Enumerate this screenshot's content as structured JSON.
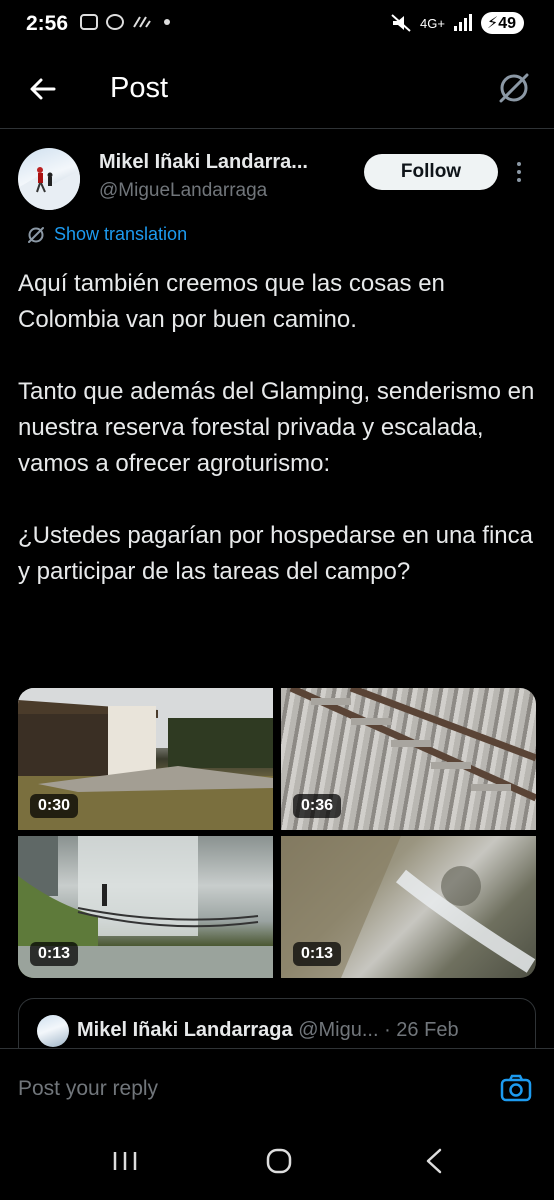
{
  "status_bar": {
    "time": "2:56",
    "network": "4G+",
    "battery": "49"
  },
  "header": {
    "title": "Post"
  },
  "author": {
    "name": "Mikel Iñaki Landarra...",
    "handle": "@MigueLandarraga"
  },
  "follow_label": "Follow",
  "translate_label": "Show translation",
  "post": {
    "text": "Aquí también creemos que las cosas en Colombia van por buen camino.\n\nTanto que además del Glamping, senderismo en nuestra reserva forestal privada y escalada, vamos a ofrecer agroturismo:\n\n¿Ustedes pagarían por hospedarse en una finca y participar de las tareas del campo?"
  },
  "media": [
    {
      "duration": "0:30"
    },
    {
      "duration": "0:36"
    },
    {
      "duration": "0:13"
    },
    {
      "duration": "0:13"
    }
  ],
  "quoted": {
    "name": "Mikel Iñaki Landarraga",
    "handle": "@Migu...",
    "date": "· 26 Feb"
  },
  "reply": {
    "placeholder": "Post your reply"
  },
  "colors": {
    "accent": "#1d9bf0",
    "background": "#000000",
    "muted": "#71767b"
  }
}
